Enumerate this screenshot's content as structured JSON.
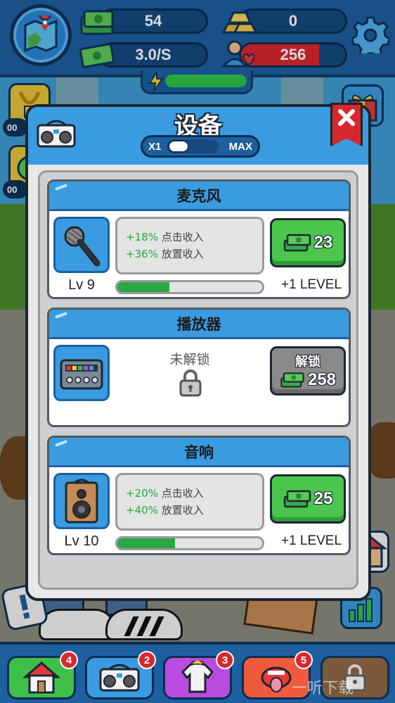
{
  "hud": {
    "cash": "54",
    "gold": "0",
    "income_rate": "3.0/S",
    "fans": "256",
    "fans_fill_pct": 75,
    "energy_fill_pct": 100
  },
  "side": {
    "timer1": "00",
    "timer2": "00"
  },
  "modal": {
    "title": "设备",
    "multiplier_min": "X1",
    "multiplier_max": "MAX"
  },
  "items": [
    {
      "name": "麦克风",
      "level": "Lv 9",
      "bonus_click_pct": "+18%",
      "bonus_click_label": "点击收入",
      "bonus_idle_pct": "+36%",
      "bonus_idle_label": "放置收入",
      "progress_pct": 36,
      "price": "23",
      "next_level": "+1 LEVEL",
      "icon": "microphone-icon"
    },
    {
      "name": "播放器",
      "status": "未解锁",
      "unlock_label": "解锁",
      "unlock_price": "258",
      "icon": "mixer-icon"
    },
    {
      "name": "音响",
      "level": "Lv 10",
      "bonus_click_pct": "+20%",
      "bonus_click_label": "点击收入",
      "bonus_idle_pct": "+40%",
      "bonus_idle_label": "放置收入",
      "progress_pct": 40,
      "price": "25",
      "next_level": "+1 LEVEL",
      "icon": "speaker-icon"
    }
  ],
  "nav": [
    {
      "icon": "house-icon",
      "badge": "4",
      "color": "#3fbf4a"
    },
    {
      "icon": "boombox-icon",
      "badge": "2",
      "color": "#3a9be0"
    },
    {
      "icon": "shirt-icon",
      "badge": "3",
      "color": "#b84ce0"
    },
    {
      "icon": "mouth-icon",
      "badge": "5",
      "color": "#f05a3c"
    },
    {
      "icon": "lock-icon",
      "badge": "",
      "color": "#7a5a3a"
    }
  ],
  "watermark": "一听下载"
}
